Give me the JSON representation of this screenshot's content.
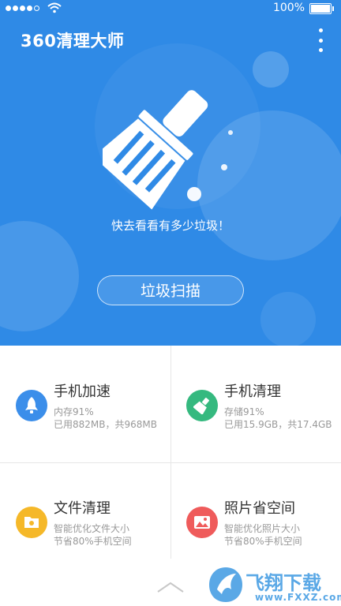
{
  "status_bar": {
    "battery": "100%"
  },
  "header": {
    "title": "360清理大师"
  },
  "hero": {
    "tagline": "快去看看有多少垃圾！",
    "scan_button": "垃圾扫描"
  },
  "tiles": [
    {
      "title": "手机加速",
      "line1": "内存91%",
      "line2": "已用882MB，共968MB",
      "icon": "rocket-icon",
      "color": "#3b8eea"
    },
    {
      "title": "手机清理",
      "line1": "存储91%",
      "line2": "已用15.9GB，共17.4GB",
      "icon": "broom-icon",
      "color": "#35b97f"
    },
    {
      "title": "文件清理",
      "line1": "智能优化文件大小",
      "line2": "节省80%手机空间",
      "icon": "file-icon",
      "color": "#f5b829"
    },
    {
      "title": "照片省空间",
      "line1": "智能优化照片大小",
      "line2": "节省80%手机空间",
      "icon": "photo-icon",
      "color": "#ef5b5b"
    }
  ],
  "watermark": {
    "title": "飞翔下载",
    "url": "www.FXXZ.com"
  },
  "colors": {
    "hero_bg": "#2f8ae6",
    "accent": "#3b8eea"
  }
}
